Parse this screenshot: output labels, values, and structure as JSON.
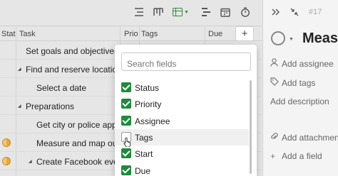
{
  "toolbar": {
    "icons": [
      "list-icon",
      "board-icon",
      "grid-view-icon",
      "gantt-icon",
      "calendar-icon",
      "timer-icon"
    ]
  },
  "table": {
    "columns": [
      "Stat",
      "Task",
      "Prior",
      "Tags",
      "Due"
    ],
    "add_column": "+",
    "rows": [
      {
        "task": "Set goals and objectives"
      },
      {
        "task": "Find and reserve location"
      },
      {
        "task": "Select a date"
      },
      {
        "task": "Preparations"
      },
      {
        "task": "Get city or police appro"
      },
      {
        "task": "Measure and map out t"
      },
      {
        "task": "Create Facebook even"
      }
    ]
  },
  "fields_menu": {
    "search_placeholder": "Search fields",
    "fields": [
      {
        "label": "Status",
        "checked": true
      },
      {
        "label": "Priority",
        "checked": true
      },
      {
        "label": "Assignee",
        "checked": true
      },
      {
        "label": "Tags",
        "checked": false
      },
      {
        "label": "Start",
        "checked": true
      },
      {
        "label": "Due",
        "checked": true
      }
    ]
  },
  "detail": {
    "task_id": "#17",
    "title": "Measu",
    "add_assignee": "Add assignee",
    "add_tags": "Add tags",
    "add_description": "Add description",
    "add_attachment": "Add attachmen",
    "add_field": "Add a field"
  },
  "colors": {
    "accent_green": "#1f8a3b",
    "avatar_orange": "#e8a83a"
  }
}
